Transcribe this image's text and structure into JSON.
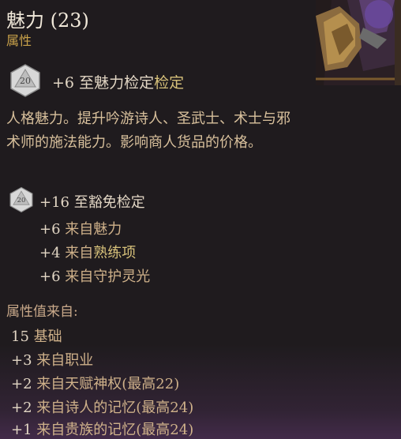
{
  "header": {
    "title": "魅力 (23)",
    "subtitle": "属性"
  },
  "check": {
    "die_value": "20",
    "bonus": "+6",
    "text": "至魅力检定",
    "highlight": "检定"
  },
  "description": "人格魅力。提升吟游诗人、圣武士、术士与邪术师的施法能力。影响商人货品的价格。",
  "save": {
    "die_value": "20",
    "bonus": "+16",
    "text": "至豁免检定",
    "breakdown": [
      {
        "value": "+6",
        "source": "来自魅力"
      },
      {
        "value": "+4",
        "source": "来自",
        "highlight": "熟练项"
      },
      {
        "value": "+6",
        "source": "来自守护灵光"
      }
    ]
  },
  "attribute": {
    "heading": "属性值来自:",
    "items": [
      {
        "value": "15",
        "label": "基础"
      },
      {
        "value": "+3",
        "label": "来自职业"
      },
      {
        "value": "+2",
        "label": "来自天赋神权(最高22)"
      },
      {
        "value": "+2",
        "label": "来自诗人的记忆(最高24)"
      },
      {
        "value": "+1",
        "label": "来自贵族的记忆(最高24)"
      }
    ]
  },
  "icons": {
    "die": "d20-icon",
    "art": "gauntlet-artwork"
  }
}
